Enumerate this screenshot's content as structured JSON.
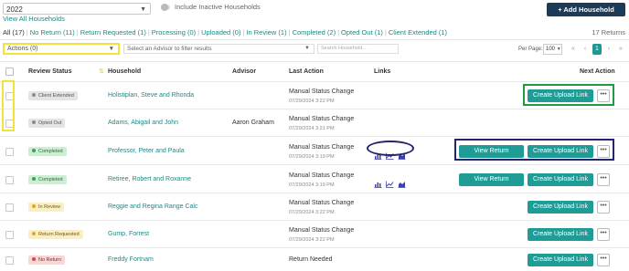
{
  "toolbar": {
    "year": "2022",
    "include_inactive_label": "Include Inactive Households",
    "add_household_label": "+ Add Household",
    "view_all_label": "View All Households"
  },
  "filters": [
    {
      "label": "All (17)",
      "active": true
    },
    {
      "label": "No Return (11)"
    },
    {
      "label": "Return Requested (1)"
    },
    {
      "label": "Processing (0)"
    },
    {
      "label": "Uploaded (0)"
    },
    {
      "label": "In Review (1)"
    },
    {
      "label": "Completed (2)"
    },
    {
      "label": "Opted Out (1)"
    },
    {
      "label": "Client Extended (1)"
    }
  ],
  "returns_count": "17 Returns",
  "controls": {
    "actions_label": "Actions (0)",
    "advisor_placeholder": "Select an Advisor to filter results",
    "search_placeholder": "Search Household...",
    "per_page_label": "Per Page:",
    "per_page_value": "100",
    "pagination": [
      "«",
      "‹",
      "1",
      "›",
      "»"
    ]
  },
  "table": {
    "headers": {
      "review_status": "Review Status",
      "household": "Household",
      "advisor": "Advisor",
      "last_action": "Last Action",
      "links": "Links",
      "next_action": "Next Action"
    },
    "rows": [
      {
        "status": "Client Extended",
        "household": "Holistiplan, Steve and Rhonda",
        "advisor": "",
        "last_action": "Manual Status Change",
        "date": "07/29/2024 3:22 PM",
        "has_links": false,
        "view_return": false,
        "upload_label": "Create Upload Link",
        "more": "•••"
      },
      {
        "status": "Opted Out",
        "household": "Adams, Abigail and John",
        "advisor": "Aaron Graham",
        "last_action": "Manual Status Change",
        "date": "07/29/2024 3:21 PM",
        "has_links": false,
        "view_return": false,
        "upload_label": "",
        "more": ""
      },
      {
        "status": "Completed",
        "household": "Professor, Peter and Paula",
        "advisor": "",
        "last_action": "Manual Status Change",
        "date": "07/29/2024 3:19 PM",
        "has_links": true,
        "view_return": true,
        "view_return_label": "View Return",
        "upload_label": "Create Upload Link",
        "more": "•••"
      },
      {
        "status": "Completed",
        "household": "Retiree, Robert and Roxanne",
        "advisor": "",
        "last_action": "Manual Status Change",
        "date": "07/29/2024 3:19 PM",
        "has_links": true,
        "view_return": true,
        "view_return_label": "View Return",
        "upload_label": "Create Upload Link",
        "more": "•••"
      },
      {
        "status": "In Review",
        "household": "Reggie and Regina Range Calc",
        "advisor": "",
        "last_action": "Manual Status Change",
        "date": "07/29/2024 3:22 PM",
        "has_links": false,
        "view_return": false,
        "upload_label": "Create Upload Link",
        "more": "•••"
      },
      {
        "status": "Return Requested",
        "household": "Gump, Forrest",
        "advisor": "",
        "last_action": "Manual Status Change",
        "date": "07/29/2024 3:22 PM",
        "has_links": false,
        "view_return": false,
        "upload_label": "Create Upload Link",
        "more": "•••"
      },
      {
        "status": "No Return",
        "household": "Freddy Fortnam",
        "advisor": "",
        "last_action": "Return Needed",
        "date": "",
        "has_links": false,
        "view_return": false,
        "upload_label": "Create Upload Link",
        "more": "•••"
      }
    ]
  },
  "status_styles": {
    "Client Extended": {
      "bg": "#e4e4e4",
      "dot": "#8a8a8a",
      "fg": "#555555"
    },
    "Opted Out": {
      "bg": "#e4e4e4",
      "dot": "#8a8a8a",
      "fg": "#555555"
    },
    "Completed": {
      "bg": "#cdeed3",
      "dot": "#3aa155",
      "fg": "#2f6b3c"
    },
    "In Review": {
      "bg": "#fbeec2",
      "dot": "#e0a91c",
      "fg": "#6b5a1a"
    },
    "Return Requested": {
      "bg": "#fbeec2",
      "dot": "#e0a91c",
      "fg": "#6b5a1a"
    },
    "No Return": {
      "bg": "#f9d6d6",
      "dot": "#d64a4a",
      "fg": "#7a2d2d"
    }
  },
  "colors": {
    "accent": "#1f9c95",
    "link": "#1b8a86",
    "add_button": "#1d3b57",
    "highlight_yellow": "#f0e33a",
    "highlight_green": "#1e9c3f",
    "highlight_navy": "#26246f"
  },
  "icons": {
    "link_icons": [
      "bar-chart-icon",
      "line-chart-icon",
      "area-chart-icon"
    ]
  }
}
